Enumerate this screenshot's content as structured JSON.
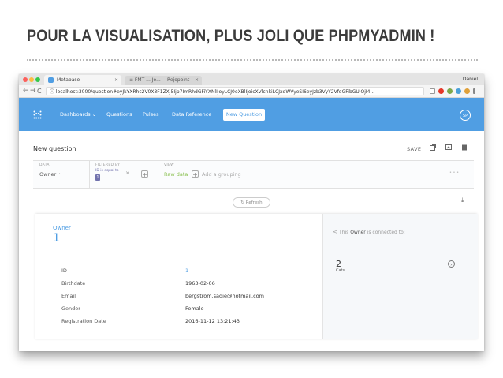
{
  "slide": {
    "title": "POUR LA VISUALISATION, PLUS JOLI QUE PHPMYADMIN !"
  },
  "browser": {
    "tabs": [
      {
        "label": "Metabase",
        "close": "×"
      },
      {
        "label": "≡ FMT ... Jo... -- Rejopoint",
        "close": "×"
      }
    ],
    "profile": "Daniel",
    "url": "ⓘ localhost:3000/question#eyJkYXRhc2V0X3F1ZXJ5Ijp7ImRhdGFiYXNlIjoyLCJ0eXBlIjoicXVlcnkiLCJxdWVyeSI6eyJzb3VyY2VfdGFibGUiOjI4...",
    "nav": {
      "back": "←",
      "forward": "→",
      "reload": "C"
    }
  },
  "app": {
    "nav": [
      {
        "label": "Dashboards ⌄"
      },
      {
        "label": "Questions"
      },
      {
        "label": "Pulses"
      },
      {
        "label": "Data Reference"
      }
    ],
    "new_question": "New Question",
    "avatar": "SP"
  },
  "question": {
    "title": "New question",
    "save": "SAVE",
    "builder": {
      "data_label": "DATA",
      "data_value": "Owner",
      "filter_label": "FILTERED BY",
      "filter_text": "ID is equal to",
      "filter_value": "1",
      "view_label": "VIEW",
      "view_value": "Raw data",
      "grouping_placeholder": "Add a grouping",
      "more": "• • •"
    },
    "refresh": "Refresh"
  },
  "record": {
    "entity_label": "Owner",
    "entity_id": "1",
    "fields": [
      {
        "name": "ID",
        "value": "1"
      },
      {
        "name": "Birthdate",
        "value": "1963-02-06"
      },
      {
        "name": "Email",
        "value": "bergstrom.sadie@hotmail.com"
      },
      {
        "name": "Gender",
        "value": "Female"
      },
      {
        "name": "Registration Date",
        "value": "2016-11-12 13:21:43"
      }
    ],
    "connected_prefix": "This",
    "connected_entity": "Owner",
    "connected_suffix": "is connected to:",
    "related_count": "2",
    "related_label": "Cats"
  },
  "colors": {
    "brand": "#509ee3",
    "filter": "#7172ad",
    "grouping": "#88bf4d"
  }
}
